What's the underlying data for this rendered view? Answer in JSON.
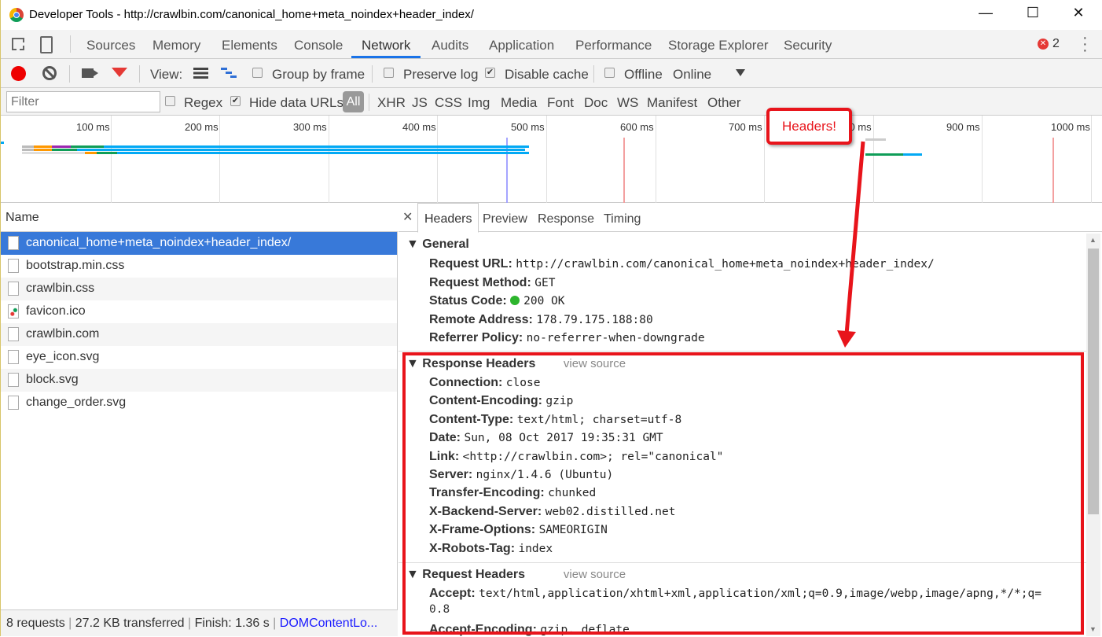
{
  "window": {
    "title": "Developer Tools - http://crawlbin.com/canonical_home+meta_noindex+header_index/",
    "minimize": "—",
    "maximize": "☐",
    "close": "✕"
  },
  "tabs": [
    "Sources",
    "Memory",
    "Elements",
    "Console",
    "Network",
    "Audits",
    "Application",
    "Performance",
    "Storage Explorer",
    "Security"
  ],
  "active_tab": "Network",
  "error_count": "2",
  "toolbar": {
    "view_label": "View:",
    "group_by_frame": "Group by frame",
    "preserve_log": "Preserve log",
    "disable_cache": "Disable cache",
    "offline": "Offline",
    "throttle": "Online"
  },
  "filter": {
    "placeholder": "Filter",
    "regex": "Regex",
    "hide_data_urls": "Hide data URLs",
    "types": [
      "All",
      "XHR",
      "JS",
      "CSS",
      "Img",
      "Media",
      "Font",
      "Doc",
      "WS",
      "Manifest",
      "Other"
    ]
  },
  "timeline": {
    "ticks": [
      "100 ms",
      "200 ms",
      "300 ms",
      "400 ms",
      "500 ms",
      "600 ms",
      "700 ms",
      "800 ms",
      "900 ms",
      "1000 ms"
    ]
  },
  "list": {
    "header": "Name",
    "items": [
      "canonical_home+meta_noindex+header_index/",
      "bootstrap.min.css",
      "crawlbin.css",
      "favicon.ico",
      "crawlbin.com",
      "eye_icon.svg",
      "block.svg",
      "change_order.svg"
    ]
  },
  "status": {
    "requests": "8 requests",
    "transferred": "27.2 KB transferred",
    "finish": "Finish: 1.36 s",
    "dom": "DOMContentLo..."
  },
  "detail_tabs": [
    "Headers",
    "Preview",
    "Response",
    "Timing"
  ],
  "general": {
    "title": "General",
    "rows": [
      {
        "k": "Request URL:",
        "v": "http://crawlbin.com/canonical_home+meta_noindex+header_index/"
      },
      {
        "k": "Request Method:",
        "v": "GET"
      },
      {
        "k": "Status Code:",
        "v": "200 OK"
      },
      {
        "k": "Remote Address:",
        "v": "178.79.175.188:80"
      },
      {
        "k": "Referrer Policy:",
        "v": "no-referrer-when-downgrade"
      }
    ]
  },
  "response_headers": {
    "title": "Response Headers",
    "view_source": "view source",
    "rows": [
      {
        "k": "Connection:",
        "v": "close"
      },
      {
        "k": "Content-Encoding:",
        "v": "gzip"
      },
      {
        "k": "Content-Type:",
        "v": "text/html; charset=utf-8"
      },
      {
        "k": "Date:",
        "v": "Sun, 08 Oct 2017 19:35:31 GMT"
      },
      {
        "k": "Link:",
        "v": "<http://crawlbin.com>; rel=\"canonical\""
      },
      {
        "k": "Server:",
        "v": "nginx/1.4.6 (Ubuntu)"
      },
      {
        "k": "Transfer-Encoding:",
        "v": "chunked"
      },
      {
        "k": "X-Backend-Server:",
        "v": "web02.distilled.net"
      },
      {
        "k": "X-Frame-Options:",
        "v": "SAMEORIGIN"
      },
      {
        "k": "X-Robots-Tag:",
        "v": "index"
      }
    ]
  },
  "request_headers": {
    "title": "Request Headers",
    "view_source": "view source",
    "rows": [
      {
        "k": "Accept:",
        "v": "text/html,application/xhtml+xml,application/xml;q=0.9,image/webp,image/apng,*/*;q=",
        "v2": "0.8"
      },
      {
        "k": "Accept-Encoding:",
        "v": "gzip, deflate"
      }
    ]
  },
  "annotation": {
    "label": "Headers!",
    "color": "#e8141b"
  }
}
